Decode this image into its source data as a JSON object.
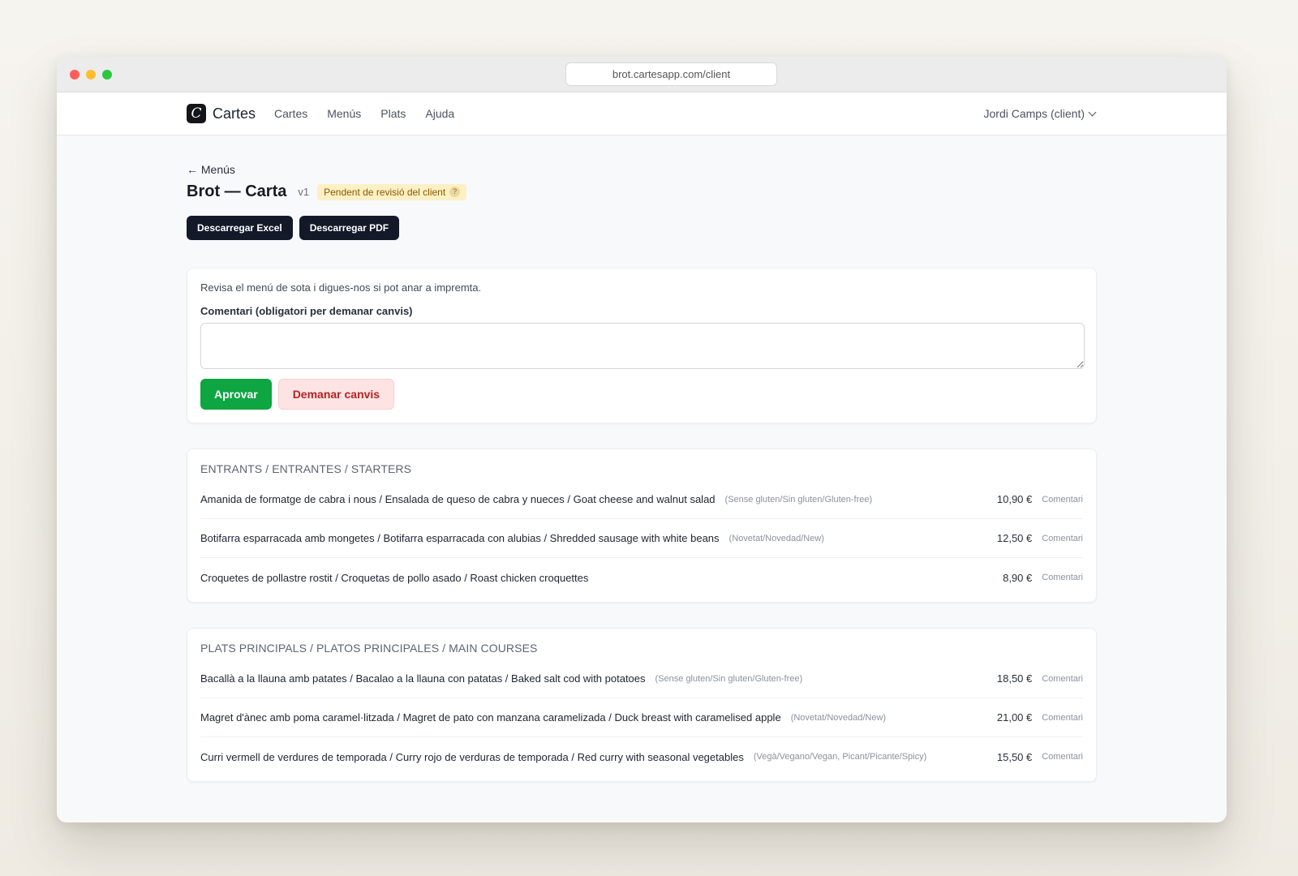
{
  "browser": {
    "url": "brot.cartesapp.com/client"
  },
  "nav": {
    "brand": "Cartes",
    "logo_letter": "C",
    "links": [
      "Cartes",
      "Menús",
      "Plats",
      "Ajuda"
    ],
    "user": "Jordi Camps (client)"
  },
  "page": {
    "back_label": "← Menús",
    "title": "Brot — Carta",
    "version": "v1",
    "status_badge": "Pendent de revisió del client",
    "help_glyph": "?",
    "download_excel": "Descarregar Excel",
    "download_pdf": "Descarregar PDF"
  },
  "review": {
    "intro": "Revisa el menú de sota i digues-nos si pot anar a impremta.",
    "comment_label": "Comentari (obligatori per demanar canvis)",
    "comment_value": "",
    "approve_label": "Aprovar",
    "request_changes_label": "Demanar canvis"
  },
  "sections": [
    {
      "title": "ENTRANTS / ENTRANTES / STARTERS",
      "items": [
        {
          "name": "Amanida de formatge de cabra i nous / Ensalada de queso de cabra y nueces / Goat cheese and walnut salad",
          "tags": "(Sense gluten/Sin gluten/Gluten-free)",
          "price": "10,90 €",
          "comment": "Comentari"
        },
        {
          "name": "Botifarra esparracada amb mongetes / Botifarra esparracada con alubias / Shredded sausage with white beans",
          "tags": "(Novetat/Novedad/New)",
          "price": "12,50 €",
          "comment": "Comentari"
        },
        {
          "name": "Croquetes de pollastre rostit / Croquetas de pollo asado / Roast chicken croquettes",
          "tags": "",
          "price": "8,90 €",
          "comment": "Comentari"
        }
      ]
    },
    {
      "title": "PLATS PRINCIPALS / PLATOS PRINCIPALES / MAIN COURSES",
      "items": [
        {
          "name": "Bacallà a la llauna amb patates / Bacalao a la llauna con patatas / Baked salt cod with potatoes",
          "tags": "(Sense gluten/Sin gluten/Gluten-free)",
          "price": "18,50 €",
          "comment": "Comentari"
        },
        {
          "name": "Magret d'ànec amb poma caramel·litzada / Magret de pato con manzana caramelizada / Duck breast with caramelised apple",
          "tags": "(Novetat/Novedad/New)",
          "price": "21,00 €",
          "comment": "Comentari"
        },
        {
          "name": "Curri vermell de verdures de temporada / Curry rojo de verduras de temporada / Red curry with seasonal vegetables",
          "tags": "(Vegà/Vegano/Vegan, Picant/Picante/Spicy)",
          "price": "15,50 €",
          "comment": "Comentari"
        }
      ]
    }
  ]
}
